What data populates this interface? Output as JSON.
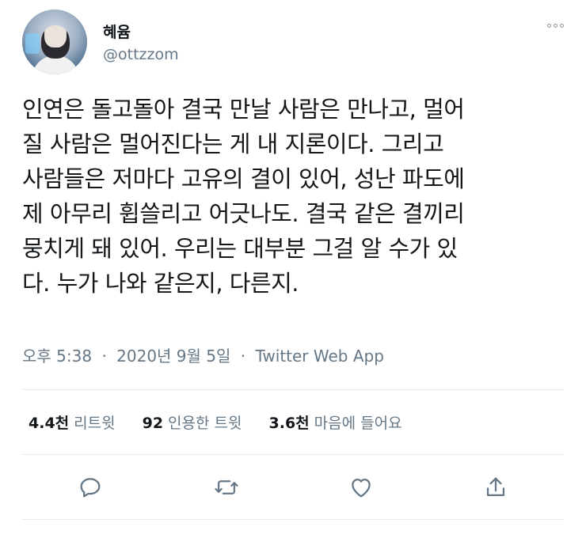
{
  "user": {
    "display_name": "혜윰",
    "handle": "@ottzzom"
  },
  "tweet": {
    "lines": [
      "인연은 돌고돌아 결국 만날 사람은 만나고, 멀어",
      "질 사람은 멀어진다는 게 내 지론이다. 그리고",
      "사람들은 저마다 고유의 결이 있어, 성난 파도에",
      "제 아무리 휩쓸리고 어긋나도. 결국 같은 결끼리",
      "뭉치게 돼 있어. 우리는 대부분 그걸 알 수가 있",
      "다. 누가 나와 같은지, 다른지."
    ]
  },
  "meta": {
    "time": "오후 5:38",
    "date": "2020년 9월 5일",
    "source": "Twitter Web App",
    "separator": "·"
  },
  "stats": {
    "retweets_count": "4.4천",
    "retweets_label": "리트윗",
    "quotes_count": "92",
    "quotes_label": "인용한 트윗",
    "likes_count": "3.6천",
    "likes_label": "마음에 들어요"
  },
  "icons": {
    "reply": "reply-icon",
    "retweet": "retweet-icon",
    "like": "heart-icon",
    "share": "share-icon",
    "more": "more-icon"
  },
  "colors": {
    "text": "#14171a",
    "secondary": "#657786",
    "divider": "#e6ecf0",
    "icon": "#657786"
  }
}
